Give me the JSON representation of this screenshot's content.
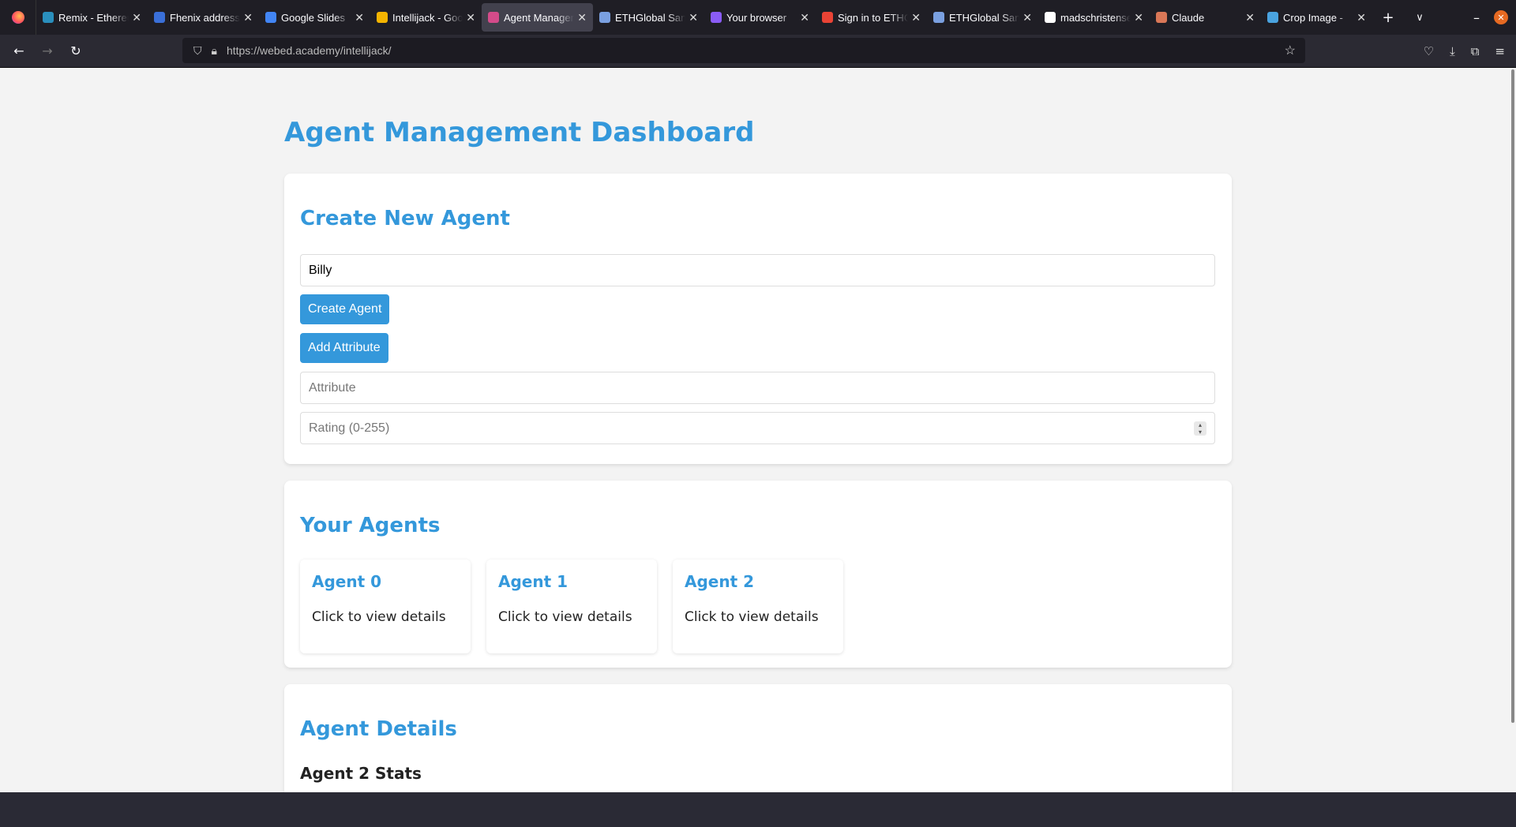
{
  "browser": {
    "tabs": [
      {
        "label": "Remix - Ethereum IDE",
        "color": "#2a8fbd"
      },
      {
        "label": "Fhenix address",
        "color": "#3a6fd8"
      },
      {
        "label": "Google Slides",
        "color": "#4285f4"
      },
      {
        "label": "Intellijack - Google Slides",
        "color": "#f4b400"
      },
      {
        "label": "Agent Management",
        "color": "#d44b8a",
        "active": true
      },
      {
        "label": "ETHGlobal San Francisco",
        "color": "#7aa0e0"
      },
      {
        "label": "Your browser",
        "color": "#8a5cf6"
      },
      {
        "label": "Sign in to ETHGlobal",
        "color": "#ea4335"
      },
      {
        "label": "ETHGlobal San Francisco",
        "color": "#7aa0e0"
      },
      {
        "label": "madschristensen",
        "color": "#ffffff"
      },
      {
        "label": "Claude",
        "color": "#d97757"
      },
      {
        "label": "Crop Image - ",
        "color": "#4aa3df"
      }
    ],
    "url": "https://webed.academy/intellijack/"
  },
  "page": {
    "title": "Agent Management Dashboard",
    "create": {
      "heading": "Create New Agent",
      "name_value": "Billy",
      "create_button": "Create Agent",
      "add_attribute_button": "Add Attribute",
      "attribute_placeholder": "Attribute",
      "rating_placeholder": "Rating (0-255)"
    },
    "agents": {
      "heading": "Your Agents",
      "items": [
        {
          "name": "Agent 0",
          "hint": "Click to view details"
        },
        {
          "name": "Agent 1",
          "hint": "Click to view details"
        },
        {
          "name": "Agent 2",
          "hint": "Click to view details"
        }
      ]
    },
    "details": {
      "heading": "Agent Details",
      "stats_title": "Agent 2 Stats"
    }
  },
  "colors": {
    "accent": "#3498db"
  }
}
